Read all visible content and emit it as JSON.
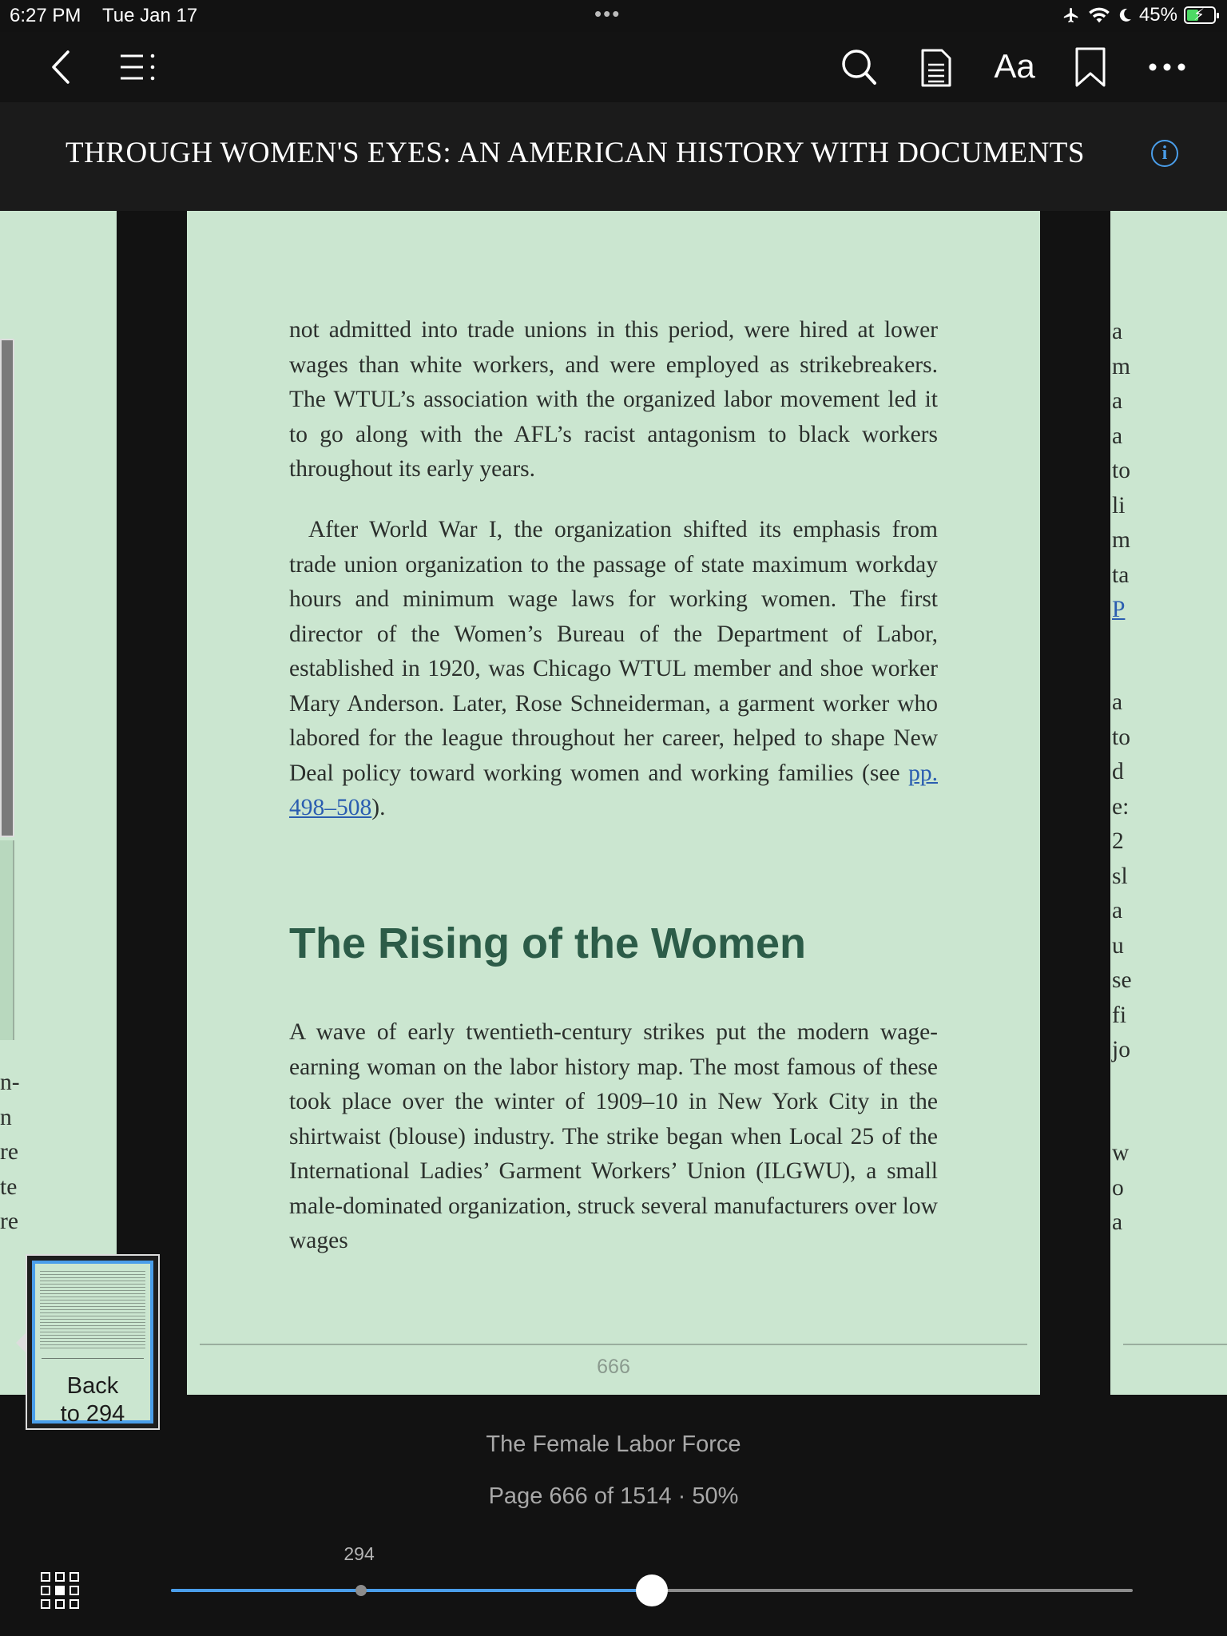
{
  "status_bar": {
    "time": "6:27 PM",
    "date": "Tue Jan 17",
    "battery": "45%",
    "dots": "•••"
  },
  "book": {
    "title": "THROUGH WOMEN'S EYES: AN AMERICAN HISTORY WITH DOCUMENTS",
    "info_icon_glyph": "i"
  },
  "page": {
    "paragraph1": "not admitted into trade unions in this period, were hired at lower wages than white workers, and were employed as strikebreakers. The WTUL’s association with the organized labor movement led it to go along with the AFL’s racist antagonism to black workers throughout its early years.",
    "paragraph2_text": "After World War I, the organization shifted its emphasis from trade union organization to the passage of state maximum workday hours and minimum wage laws for working women. The first director of the Women’s Bureau of the Department of Labor, established in 1920, was Chicago WTUL member and shoe worker Mary Anderson. Later, Rose Schneiderman, a garment worker who labored for the league throughout her career, helped to shape New Deal policy toward working women and working families (see ",
    "paragraph2_link": "pp. 498–508",
    "paragraph2_end": ").",
    "heading": "The Rising of the Women",
    "paragraph3": "A wave of early twentieth-century strikes put the modern wage-earning woman on the labor history map. The most famous of these took place over the winter of 1909–10 in New York City in the shirtwaist (blouse) industry. The strike began when Local 25 of the International Ladies’ Garment Workers’ Union (ILGWU), a small male-dominated organization, struck several manufacturers over low wages",
    "page_number": "666"
  },
  "left_page": {
    "fragments": [
      "n-",
      "n",
      "re",
      "te",
      "re"
    ]
  },
  "right_page": {
    "fragments_a": [
      "a",
      "m",
      "a",
      "a",
      "to",
      "li",
      "m",
      "ta"
    ],
    "link_fragment": "P",
    "fragments_b": [
      "a",
      "to",
      "d",
      "e:",
      "2",
      "sl",
      "a",
      "u",
      "se",
      "fi",
      "jo"
    ],
    "fragments_c": [
      "w",
      "o",
      "a"
    ]
  },
  "back_button": {
    "line1": "Back",
    "line2": "to 294"
  },
  "footer": {
    "chapter": "The Female Labor Force",
    "page_info": "Page 666 of 1514 · 50%",
    "slider_marker_label": "294",
    "slider_marker_fraction": 0.198,
    "slider_progress": 0.5
  },
  "colors": {
    "page_background": "#cbe6d0",
    "accent": "#4a9eea",
    "heading": "#2c5c48",
    "link": "#2a5db0"
  }
}
